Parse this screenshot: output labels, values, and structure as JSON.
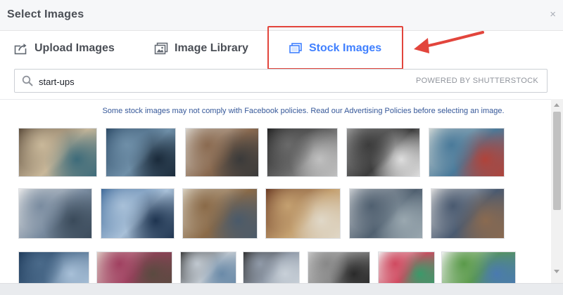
{
  "dialog": {
    "title": "Select Images",
    "close_glyph": "×"
  },
  "tabs": [
    {
      "label": "Upload Images",
      "icon": "upload-icon",
      "active": false
    },
    {
      "label": "Image Library",
      "icon": "image-library-icon",
      "active": false
    },
    {
      "label": "Stock Images",
      "icon": "stock-images-icon",
      "active": true
    }
  ],
  "search": {
    "value": "start-ups",
    "placeholder": "",
    "powered_by": "POWERED BY SHUTTERSTOCK"
  },
  "notice": "Some stock images may not comply with Facebook policies. Read our Advertising Policies before selecting an image.",
  "colors": {
    "accent": "#4080ff",
    "highlight": "#e2453c",
    "link": "#365899"
  },
  "thumbnails": [
    {
      "row": 1,
      "subject": "top-down desk meeting",
      "palette": [
        "#5a4a3a",
        "#c9b89a",
        "#3d6b7a"
      ]
    },
    {
      "row": 1,
      "subject": "businessman in blue city",
      "palette": [
        "#2c4a66",
        "#6f8fa8",
        "#1a2a3a"
      ]
    },
    {
      "row": 1,
      "subject": "team at laptop",
      "palette": [
        "#d9d4cc",
        "#8a6a50",
        "#3a3a3a"
      ]
    },
    {
      "row": 1,
      "subject": "startup chalkboard",
      "palette": [
        "#222222",
        "#6a6a6a",
        "#c0c0c0"
      ]
    },
    {
      "row": 1,
      "subject": "skyscrapers grayscale",
      "palette": [
        "#9a9a9a",
        "#3c3c3c",
        "#dedede"
      ]
    },
    {
      "row": 1,
      "subject": "hands planning table",
      "palette": [
        "#cfd6d4",
        "#4a7a9a",
        "#b0433a"
      ]
    },
    {
      "row": 2,
      "subject": "men at computer",
      "palette": [
        "#e8e8e8",
        "#7a8ca0",
        "#3a4a5a"
      ]
    },
    {
      "row": 2,
      "subject": "finger touching icon",
      "palette": [
        "#3f6a9a",
        "#a8c0d8",
        "#1e3450"
      ]
    },
    {
      "row": 2,
      "subject": "group around laptop",
      "palette": [
        "#d8d0c0",
        "#8a6a48",
        "#4a5a6a"
      ]
    },
    {
      "row": 2,
      "subject": "start up note on wood",
      "palette": [
        "#6a3a24",
        "#c4a070",
        "#e0d8c8"
      ]
    },
    {
      "row": 2,
      "subject": "open office meeting",
      "palette": [
        "#c8ccd0",
        "#506070",
        "#9aa8b0"
      ]
    },
    {
      "row": 2,
      "subject": "team at whiteboard",
      "palette": [
        "#dcdcdc",
        "#4a5a70",
        "#8a6a50"
      ]
    },
    {
      "row": 3,
      "subject": "business sketch dark",
      "palette": [
        "#1e3a5a",
        "#4a6a8a",
        "#a8c0d8"
      ]
    },
    {
      "row": 3,
      "subject": "casual team",
      "palette": [
        "#e0d0c8",
        "#a04060",
        "#5a4a40"
      ]
    },
    {
      "row": 3,
      "subject": "laptop infographic",
      "palette": [
        "#3a3a3a",
        "#c0c8d0",
        "#6a8aa8"
      ]
    },
    {
      "row": 3,
      "subject": "hands on laptop",
      "palette": [
        "#2e2e2e",
        "#909aa8",
        "#c8d0d8"
      ]
    },
    {
      "row": 3,
      "subject": "man climbing steps",
      "palette": [
        "#c8c8c8",
        "#888888",
        "#2a2a2a"
      ]
    },
    {
      "row": 3,
      "subject": "colorful doodles",
      "palette": [
        "#f0f0f0",
        "#d04a60",
        "#3a9a6a"
      ]
    },
    {
      "row": 3,
      "subject": "drawn tree diagram",
      "palette": [
        "#f4f4f4",
        "#5a9a4a",
        "#4a7ab0"
      ]
    }
  ]
}
